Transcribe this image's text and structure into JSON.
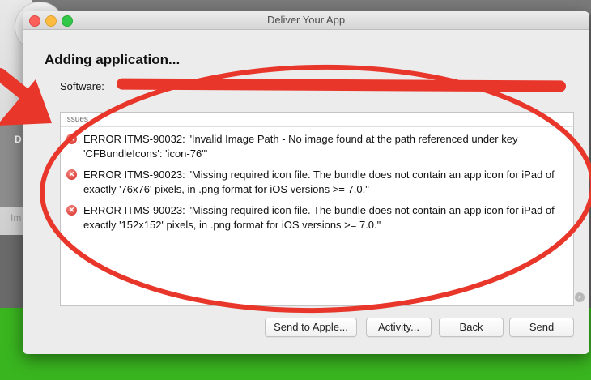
{
  "window": {
    "title": "Deliver Your App",
    "heading": "Adding application...",
    "software_label": "Software:"
  },
  "issues": {
    "header": "Issues",
    "items": [
      {
        "text": "ERROR ITMS-90032: \"Invalid Image Path - No image found at the path referenced under key 'CFBundleIcons': 'icon-76'\""
      },
      {
        "text": "ERROR ITMS-90023: \"Missing required icon file. The bundle does not contain an app icon for iPad of exactly '76x76' pixels, in .png format for iOS versions >= 7.0.\""
      },
      {
        "text": "ERROR ITMS-90023: \"Missing required icon file. The bundle does not contain an app icon for iPad of exactly '152x152' pixels, in .png format for iOS versions >= 7.0.\""
      }
    ]
  },
  "buttons": {
    "send_to_apple": "Send to Apple...",
    "activity": "Activity...",
    "back": "Back",
    "send": "Send"
  },
  "background": {
    "letter_d": "D",
    "im_text": "Im"
  },
  "colors": {
    "annotation_red": "#e8362b",
    "desktop_green": "#39b51f",
    "error_red": "#d3261e"
  },
  "icons": {
    "error": "error-icon",
    "search": "magnifier-icon"
  }
}
